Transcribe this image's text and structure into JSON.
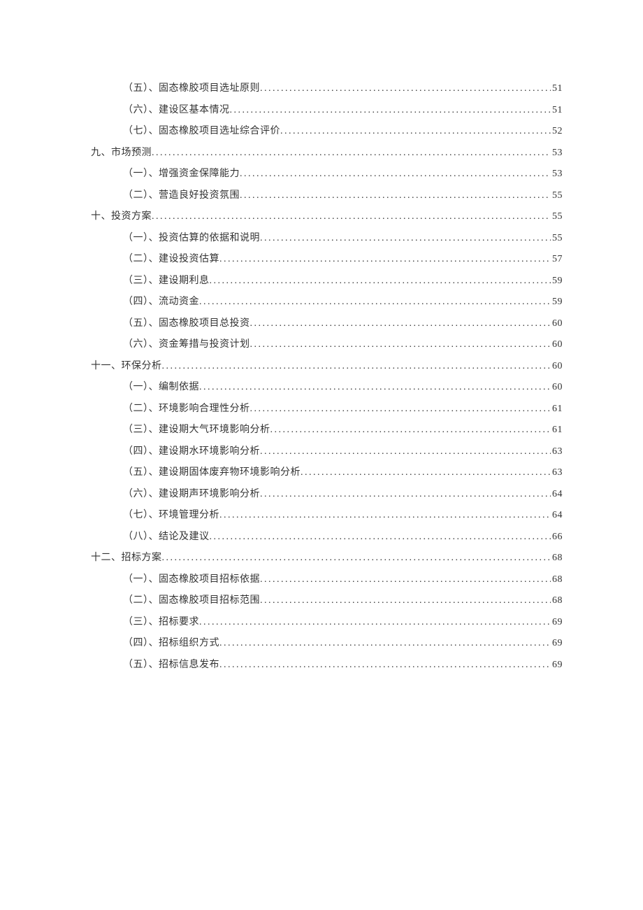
{
  "toc": [
    {
      "level": 2,
      "label": "（五）、固态橡胶项目选址原则",
      "page": "51"
    },
    {
      "level": 2,
      "label": "（六）、建设区基本情况",
      "page": "51"
    },
    {
      "level": 2,
      "label": "（七）、固态橡胶项目选址综合评价",
      "page": "52"
    },
    {
      "level": 1,
      "label": "九、市场预测",
      "page": "53"
    },
    {
      "level": 2,
      "label": "（一）、增强资金保障能力",
      "page": "53"
    },
    {
      "level": 2,
      "label": "（二）、营造良好投资氛围",
      "page": "55"
    },
    {
      "level": 1,
      "label": "十、投资方案",
      "page": "55"
    },
    {
      "level": 2,
      "label": "（一）、投资估算的依据和说明",
      "page": "55"
    },
    {
      "level": 2,
      "label": "（二）、建设投资估算",
      "page": "57"
    },
    {
      "level": 2,
      "label": "（三）、建设期利息",
      "page": "59"
    },
    {
      "level": 2,
      "label": "（四）、流动资金",
      "page": "59"
    },
    {
      "level": 2,
      "label": "（五）、固态橡胶项目总投资",
      "page": "60"
    },
    {
      "level": 2,
      "label": "（六）、资金筹措与投资计划",
      "page": "60"
    },
    {
      "level": 1,
      "label": "十一、环保分析",
      "page": "60"
    },
    {
      "level": 2,
      "label": "（一）、编制依据",
      "page": "60"
    },
    {
      "level": 2,
      "label": "（二）、环境影响合理性分析",
      "page": "61"
    },
    {
      "level": 2,
      "label": "（三）、建设期大气环境影响分析",
      "page": "61"
    },
    {
      "level": 2,
      "label": "（四）、建设期水环境影响分析",
      "page": "63"
    },
    {
      "level": 2,
      "label": "（五）、建设期固体废弃物环境影响分析",
      "page": "63"
    },
    {
      "level": 2,
      "label": "（六）、建设期声环境影响分析",
      "page": "64"
    },
    {
      "level": 2,
      "label": "（七）、环境管理分析",
      "page": "64"
    },
    {
      "level": 2,
      "label": "（八）、结论及建议",
      "page": "66"
    },
    {
      "level": 1,
      "label": "十二、招标方案",
      "page": "68"
    },
    {
      "level": 2,
      "label": "（一）、固态橡胶项目招标依据",
      "page": "68"
    },
    {
      "level": 2,
      "label": "（二）、固态橡胶项目招标范围",
      "page": "68"
    },
    {
      "level": 2,
      "label": "（三）、招标要求",
      "page": "69"
    },
    {
      "level": 2,
      "label": "（四）、招标组织方式",
      "page": "69"
    },
    {
      "level": 2,
      "label": "（五）、招标信息发布",
      "page": "69"
    }
  ]
}
